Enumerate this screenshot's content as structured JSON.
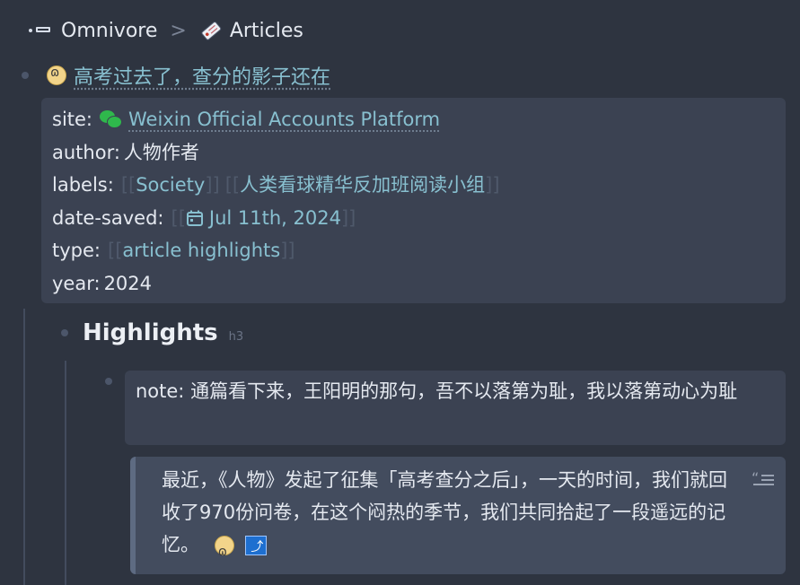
{
  "breadcrumb": {
    "root": "Omnivore",
    "separator": ">",
    "current": "Articles"
  },
  "page": {
    "title": "高考过去了，查分的影子还在"
  },
  "properties": {
    "site_key": "site:",
    "site_value": "Weixin Official Accounts Platform",
    "author_key": "author:",
    "author_value": "人物作者",
    "labels_key": "labels:",
    "labels": [
      "Society",
      "人类看球精华反加班阅读小组"
    ],
    "date_key": "date-saved:",
    "date_value": "Jul 11th, 2024",
    "type_key": "type:",
    "type_value": "article highlights",
    "year_key": "year:",
    "year_value": "2024"
  },
  "brackets": {
    "open": "[[",
    "close": "]]"
  },
  "highlights": {
    "heading": "Highlights",
    "heading_tag": "h3",
    "note_key": "note:",
    "note_text": "通篇看下来，王阳明的那句，吾不以落第为耻，我以落第动心为耻",
    "quote_text": "最近，《人物》发起了征集「高考查分之后」，一天的时间，我们就回收了970份问卷，在这个闷热的季节，我们共同拾起了一段遥远的记忆。"
  },
  "colors": {
    "background": "#2e3440",
    "block": "#3b4252",
    "link": "#88c0d0",
    "text": "#e5e9f0"
  },
  "icons": {
    "breadcrumb_root": "dot-dash-icon",
    "breadcrumb_separator": "chevron-right-icon",
    "articles": "tag-icon",
    "omnivore": "omnivore-logo-icon",
    "site": "wechat-icon",
    "date": "calendar-icon",
    "quote": "quote-icon",
    "jump": "jump-link-icon"
  }
}
